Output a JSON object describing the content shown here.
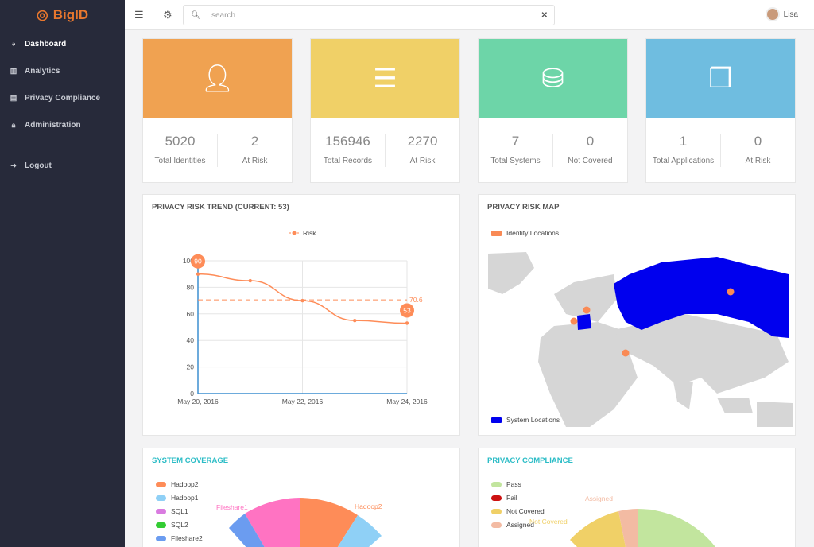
{
  "brand": "BigID",
  "sidebar": {
    "items": [
      {
        "label": "Dashboard",
        "icon": "dashboard-icon"
      },
      {
        "label": "Analytics",
        "icon": "bar-chart-icon"
      },
      {
        "label": "Privacy Compliance",
        "icon": "book-icon"
      },
      {
        "label": "Administration",
        "icon": "lock-icon"
      }
    ],
    "logout": "Logout"
  },
  "topbar": {
    "search_placeholder": "search",
    "user": "Lisa"
  },
  "cards": [
    {
      "color": "#f0a251",
      "icon": "user-icon",
      "stats": [
        {
          "value": "5020",
          "label": "Total Identities"
        },
        {
          "value": "2",
          "label": "At Risk"
        }
      ]
    },
    {
      "color": "#f0d067",
      "icon": "list-icon",
      "stats": [
        {
          "value": "156946",
          "label": "Total Records"
        },
        {
          "value": "2270",
          "label": "At Risk"
        }
      ]
    },
    {
      "color": "#6dd5a8",
      "icon": "database-icon",
      "stats": [
        {
          "value": "7",
          "label": "Total Systems"
        },
        {
          "value": "0",
          "label": "Not Covered"
        }
      ]
    },
    {
      "color": "#6fbde0",
      "icon": "cubes-icon",
      "stats": [
        {
          "value": "1",
          "label": "Total Applications"
        },
        {
          "value": "0",
          "label": "At Risk"
        }
      ]
    }
  ],
  "trend": {
    "title": "PRIVACY RISK TREND (CURRENT: 53)"
  },
  "map": {
    "title": "PRIVACY RISK MAP",
    "legend_identity": "Identity Locations",
    "legend_system": "System Locations"
  },
  "coverage": {
    "title": "SYSTEM COVERAGE",
    "legend": [
      "Hadoop2",
      "Hadoop1",
      "SQL1",
      "SQL2",
      "Fileshare2"
    ],
    "label_fileshare1": "Fileshare1",
    "label_hadoop2": "Hadoop2"
  },
  "compliance": {
    "title": "PRIVACY COMPLIANCE",
    "legend": [
      "Pass",
      "Fail",
      "Not Covered",
      "Assigned"
    ],
    "label_assigned": "Assigned",
    "label_not_covered": "Not Covered"
  },
  "chart_data": {
    "type": "line",
    "title": "PRIVACY RISK TREND (CURRENT: 53)",
    "series": [
      {
        "name": "Risk",
        "values": [
          90,
          85,
          70,
          55,
          53
        ]
      }
    ],
    "x_index": [
      0,
      1,
      2,
      3,
      4
    ],
    "xticks": [
      "May 20, 2016",
      "May 22, 2016",
      "May 24, 2016"
    ],
    "yticks": [
      0,
      20,
      40,
      60,
      80,
      100
    ],
    "ylim": [
      0,
      100
    ],
    "average": 70.6,
    "markers": {
      "max": "90",
      "current": "53"
    },
    "average_label": "70.6"
  }
}
